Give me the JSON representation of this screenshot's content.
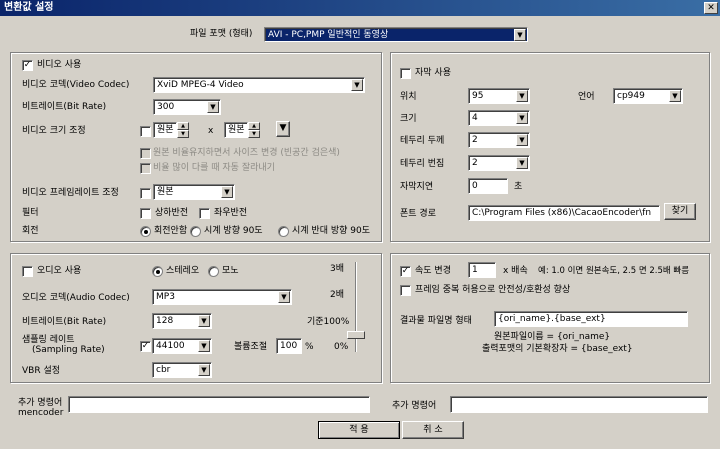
{
  "window": {
    "title": "변환값 설정",
    "close": "✕"
  },
  "file_format": {
    "label": "파일 포맷 (형태)",
    "value": "AVI - PC,PMP 일반적인 동영상"
  },
  "video": {
    "enable_label": "비디오 사용",
    "enabled": true,
    "codec_label": "비디오 코덱(Video Codec)",
    "codec_value": "XviD MPEG-4 Video",
    "bitrate_label": "비트레이트(Bit Rate)",
    "bitrate_value": "300",
    "size_label": "비디오 크기 조정",
    "size_w": "원본",
    "size_x": "x",
    "size_h": "원본",
    "size_btn": "▼",
    "keep_ratio": "원본 비율유지하면서 사이즈 변경 (빈공간 검은색)",
    "crop": "비율 많이 다를 때 자동 잘라내기",
    "fps_label": "비디오 프레임레이트 조정",
    "fps_value": "원본",
    "filter_label": "필터",
    "flip_v": "상하반전",
    "flip_h": "좌우반전",
    "rotate_label": "회전",
    "rot_none": "회전안함",
    "rot_cw": "시계 방향 90도",
    "rot_ccw": "시계 반대 방향 90도"
  },
  "subtitle": {
    "enable_label": "자막 사용",
    "pos_label": "위치",
    "pos_value": "95",
    "lang_label": "언어",
    "lang_value": "cp949",
    "size_label": "크기",
    "size_value": "4",
    "border_label": "테두리 두께",
    "border_value": "2",
    "blur_label": "테두리 번짐",
    "blur_value": "2",
    "delay_label": "자막지연",
    "delay_value": "0",
    "delay_unit": "초",
    "font_label": "폰트 경로",
    "font_value": "C:\\Program Files (x86)\\CacaoEncoder\\fn",
    "browse": "찾기"
  },
  "audio": {
    "enable_label": "오디오 사용",
    "stereo": "스테레오",
    "mono": "모노",
    "codec_label": "오디오 코덱(Audio Codec)",
    "codec_value": "MP3",
    "bitrate_label": "비트레이트(Bit Rate)",
    "bitrate_value": "128",
    "sample_label1": "샘플링 레이트",
    "sample_label2": "(Sampling Rate)",
    "sample_value": "44100",
    "volume_label": "볼륨조절",
    "volume_value": "100",
    "volume_unit": "%",
    "vbr_label": "VBR 설정",
    "vbr_value": "cbr",
    "scale": [
      "3배",
      "2배",
      "기준100%",
      "0%"
    ]
  },
  "speed": {
    "enable_label": "속도 변경",
    "value": "1",
    "unit": "x 배속",
    "hint": "예: 1.0 이면 원본속도, 2.5 면 2.5배 빠름",
    "dup_label": "프레임 중복 허용으로 안전성/호환성 향상",
    "result_label": "결과물 파일명 형태",
    "result_value": "{ori_name}.{base_ext}",
    "note1": "원본파일이름 = {ori_name}",
    "note2": "출력포맷의 기본확장자 = {base_ext}"
  },
  "extra": {
    "mencoder_l1": "추가 명령어",
    "mencoder_l2": "mencoder",
    "mencoder_value": "",
    "other_label": "추가 명령어",
    "other_value": ""
  },
  "buttons": {
    "apply": "적 용",
    "cancel": "취 소"
  },
  "colors": {
    "titlebar": "#0a246a",
    "face": "#d4d0c8",
    "selection": "#0a246a"
  }
}
